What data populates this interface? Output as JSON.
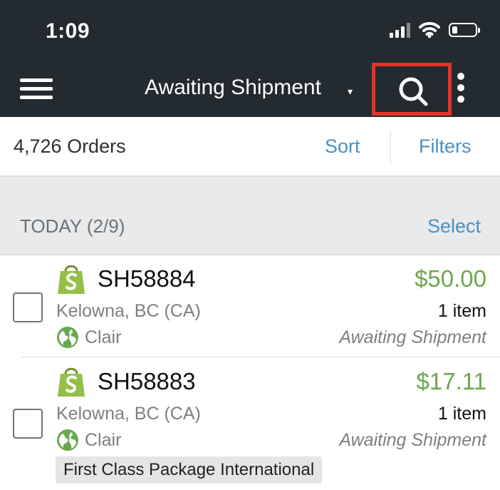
{
  "status_bar": {
    "time": "1:09"
  },
  "app_bar": {
    "view_title": "Awaiting Shipment",
    "caret": "▾"
  },
  "orders_bar": {
    "count_label": "4,726 Orders",
    "sort_label": "Sort",
    "filters_label": "Filters"
  },
  "section": {
    "title": "TODAY (2/9)",
    "select_label": "Select"
  },
  "orders": [
    {
      "id": "SH58884",
      "location": "Kelowna, BC (CA)",
      "customer": "Clair",
      "price": "$50.00",
      "items": "1 item",
      "status": "Awaiting Shipment"
    },
    {
      "id": "SH58883",
      "location": "Kelowna, BC (CA)",
      "customer": "Clair",
      "price": "$17.11",
      "items": "1 item",
      "status": "Awaiting Shipment",
      "service": "First Class Package International"
    }
  ],
  "icons": {
    "store": "shopify-bag-icon",
    "globe": "globe-icon",
    "search": "search-icon",
    "menu": "hamburger-menu-icon",
    "more": "more-vertical-icon"
  },
  "colors": {
    "header_bg": "#232a30",
    "accent_link": "#4a90c7",
    "price_green": "#6aa84f",
    "highlight_red": "#e5332a"
  }
}
